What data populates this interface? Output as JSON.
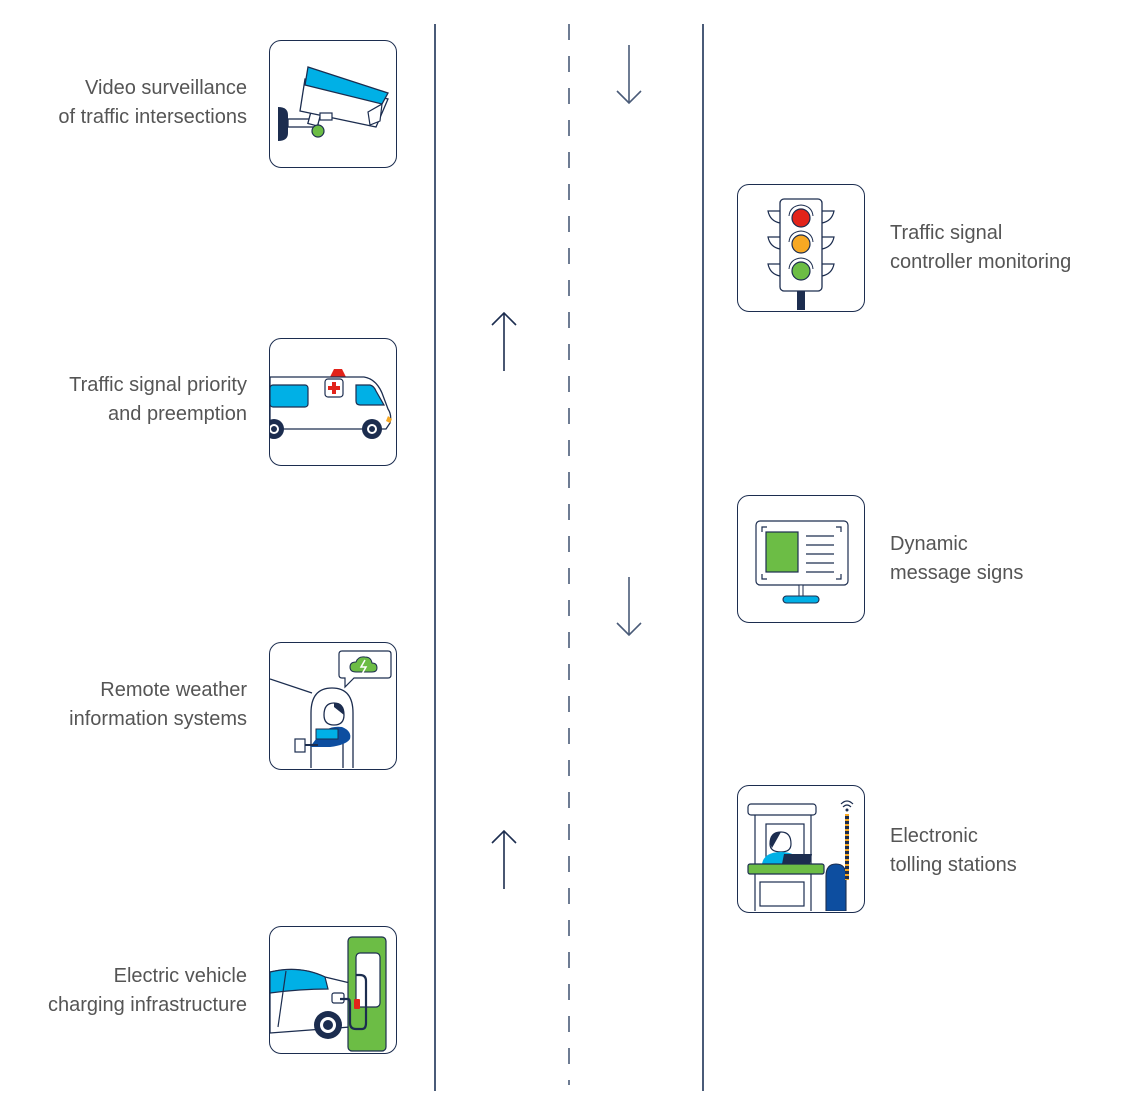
{
  "colors": {
    "navy": "#1c2d4f",
    "road": "#4a5b78",
    "cyan": "#00b0e6",
    "green": "#6cbd45",
    "red": "#e2231a",
    "amber": "#f7a823",
    "blue": "#0d4ea0",
    "text": "#555555"
  },
  "lanes": {
    "arrows": [
      {
        "name": "down-arrow-top",
        "direction": "down"
      },
      {
        "name": "up-arrow-upper",
        "direction": "up"
      },
      {
        "name": "down-arrow-middle",
        "direction": "down"
      },
      {
        "name": "up-arrow-lower",
        "direction": "up"
      }
    ]
  },
  "items": {
    "video_surveillance": {
      "icon": "security-camera-icon",
      "line1": "Video surveillance",
      "line2": "of traffic intersections"
    },
    "signal_priority": {
      "icon": "ambulance-icon",
      "line1": "Traffic signal priority",
      "line2": "and preemption"
    },
    "weather": {
      "icon": "weather-station-icon",
      "line1": "Remote weather",
      "line2": "information systems"
    },
    "ev_charging": {
      "icon": "ev-charger-icon",
      "line1": "Electric vehicle",
      "line2": "charging infrastructure"
    },
    "signal_controller": {
      "icon": "traffic-light-icon",
      "line1": "Traffic signal",
      "line2": "controller monitoring"
    },
    "message_signs": {
      "icon": "message-sign-icon",
      "line1": "Dynamic",
      "line2": "message signs"
    },
    "tolling": {
      "icon": "toll-booth-icon",
      "line1": "Electronic",
      "line2": "tolling stations"
    }
  }
}
